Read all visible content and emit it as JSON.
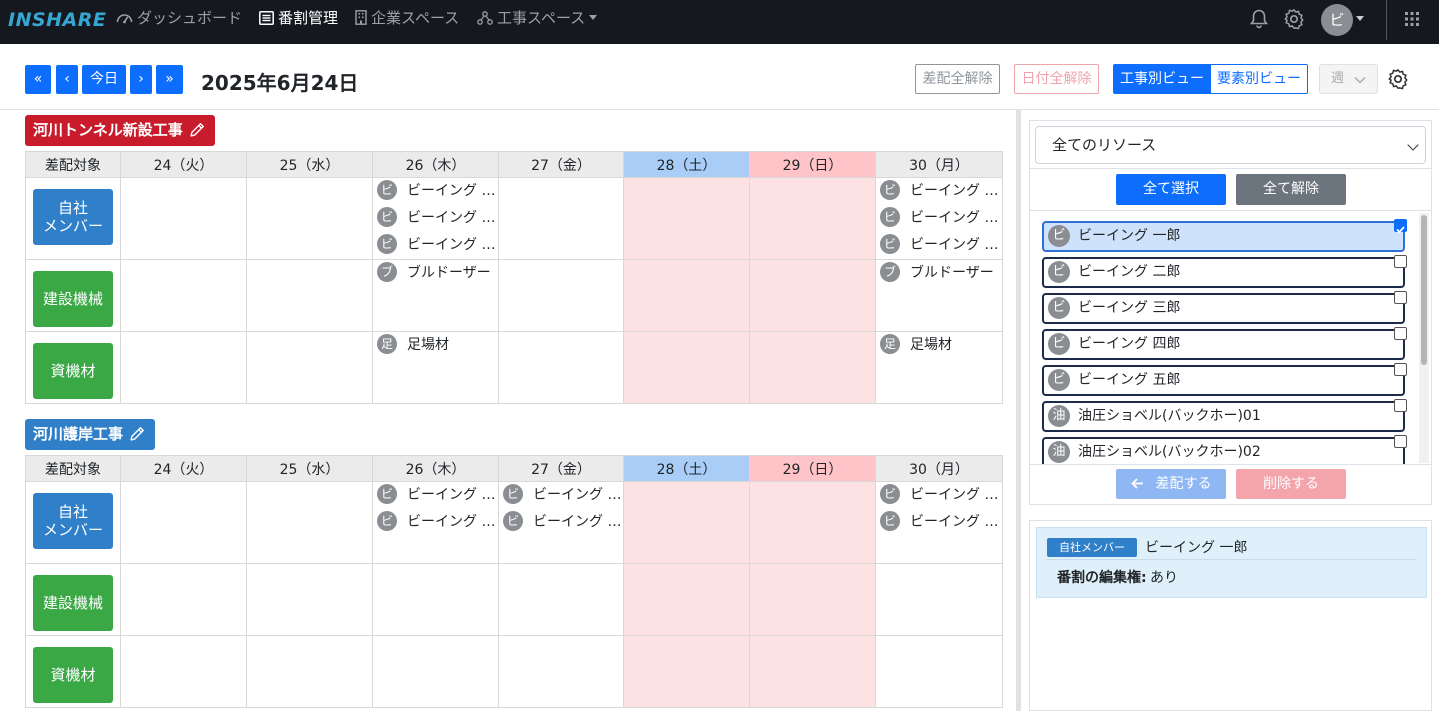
{
  "nav": {
    "logo": "INSHARE",
    "items": [
      {
        "label": "ダッシュボード",
        "icon": "dashboard-icon"
      },
      {
        "label": "番割管理",
        "icon": "list-icon",
        "active": true
      },
      {
        "label": "企業スペース",
        "icon": "building-icon"
      },
      {
        "label": "工事スペース",
        "icon": "network-icon",
        "dropdown": true
      }
    ],
    "avatar": "ビ"
  },
  "toolbar": {
    "first": "«",
    "prev": "‹",
    "today": "今日",
    "next": "›",
    "last": "»",
    "date": "2025年6月24日",
    "clear_assign": "差配全解除",
    "clear_date": "日付全解除",
    "view_by_project": "工事別ビュー",
    "view_by_element": "要素別ビュー",
    "period": "週"
  },
  "calendar": {
    "header": {
      "target": "差配対象",
      "days": [
        "24（火）",
        "25（水）",
        "26（木）",
        "27（金）",
        "28（土）",
        "29（日）",
        "30（月）"
      ]
    },
    "categories": {
      "member": "自社\nメンバー",
      "machine": "建設機械",
      "material": "資機材"
    },
    "projects": [
      {
        "name": "河川トンネル新設工事",
        "color": "#c81b2b",
        "rows": {
          "member": [
            [],
            [],
            [
              "ビーイング 一郎",
              "ビーイング 二郎",
              "ビーイング 三郎"
            ],
            [],
            [],
            [],
            [
              "ビーイング 一郎",
              "ビーイング 二郎",
              "ビーイング 三郎"
            ]
          ],
          "machine": [
            [],
            [],
            [
              "ブルドーザー"
            ],
            [],
            [],
            [],
            [
              "ブルドーザー"
            ]
          ],
          "material": [
            [],
            [],
            [
              "足場材"
            ],
            [],
            [],
            [],
            [
              "足場材"
            ]
          ]
        }
      },
      {
        "name": "河川護岸工事",
        "color": "#2f80c9",
        "rows": {
          "member": [
            [],
            [],
            [
              "ビーイング 四郎",
              "ビーイング 五郎"
            ],
            [
              "ビーイング 四郎",
              "ビーイング 五郎"
            ],
            [],
            [],
            [
              "ビーイング 四郎",
              "ビーイング 五郎"
            ]
          ],
          "machine": [
            [],
            [],
            [],
            [],
            [],
            [],
            []
          ],
          "material": [
            [],
            [],
            [],
            [],
            [],
            [],
            []
          ]
        }
      }
    ]
  },
  "resources": {
    "filter": "全てのリソース",
    "select_all": "全て選択",
    "clear_all": "全て解除",
    "items": [
      {
        "initial": "ビ",
        "name": "ビーイング 一郎",
        "checked": true
      },
      {
        "initial": "ビ",
        "name": "ビーイング 二郎",
        "checked": false
      },
      {
        "initial": "ビ",
        "name": "ビーイング 三郎",
        "checked": false
      },
      {
        "initial": "ビ",
        "name": "ビーイング 四郎",
        "checked": false
      },
      {
        "initial": "ビ",
        "name": "ビーイング 五郎",
        "checked": false
      },
      {
        "initial": "油",
        "name": "油圧ショベル(バックホー)01",
        "checked": false
      },
      {
        "initial": "油",
        "name": "油圧ショベル(バックホー)02",
        "checked": false
      }
    ],
    "assign": "差配する",
    "delete": "削除する"
  },
  "info": {
    "badge": "自社メンバー",
    "name": "ビーイング 一郎",
    "perm_label": "番割の編集権:",
    "perm_value": "あり"
  },
  "colors": {
    "primary": "#0d6efd",
    "danger": "#c81b2b",
    "member": "#2f80c9",
    "green": "#3aa845",
    "saturday": "#a9cdf7",
    "sunday": "#ffc4c8",
    "weekend_cell": "#fde2e4"
  }
}
